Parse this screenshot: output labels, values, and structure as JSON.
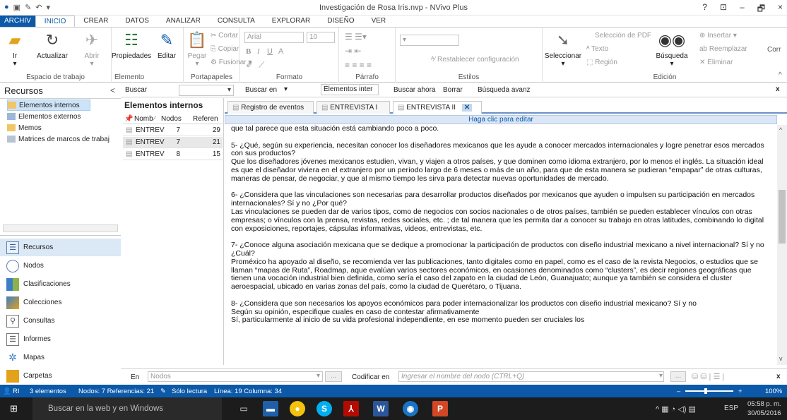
{
  "window": {
    "title": "Investigación de Rosa Iris.nvp - NVivo Plus",
    "controls": [
      "?",
      "⊡",
      "–",
      "🗗",
      "×"
    ]
  },
  "ribbon_tabs": [
    "ARCHIV",
    "INICIO",
    "CREAR",
    "DATOS",
    "ANALIZAR",
    "CONSULTA",
    "EXPLORAR",
    "DISEÑO",
    "VER"
  ],
  "ribbon": {
    "workspace": {
      "ir": "Ir",
      "actualizar": "Actualizar",
      "abrir": "Abrir",
      "label": "Espacio de trabajo"
    },
    "elemento": {
      "propiedades": "Propiedades",
      "editar": "Editar",
      "label": "Elemento"
    },
    "clipboard": {
      "pegar": "Pegar",
      "cortar": "Cortar",
      "copiar": "Copiar",
      "fusionar": "Fusionar",
      "label": "Portapapeles"
    },
    "formato": {
      "font": "Arial",
      "size": "10",
      "bold": "B",
      "italic": "I",
      "underline": "U",
      "fontcolor": "A",
      "label": "Formato"
    },
    "parrafo": {
      "label": "Párrafo"
    },
    "estilos": {
      "reset": "Restablecer configuración",
      "label": "Estilos"
    },
    "edicion": {
      "seleccionar": "Seleccionar",
      "seleccion_pdf": "Selección de PDF",
      "texto": "Texto",
      "region": "Región",
      "busqueda": "Búsqueda",
      "insertar": "Insertar",
      "reemplazar": "Reemplazar",
      "eliminar": "Eliminar",
      "label": "Edición",
      "cor": "Corr"
    }
  },
  "left_panel": {
    "title": "Recursos",
    "tree": [
      "Elementos internos",
      "Elementos externos",
      "Memos",
      "Matrices de marcos de trabaj"
    ],
    "nav": [
      "Recursos",
      "Nodos",
      "Clasificaciones",
      "Colecciones",
      "Consultas",
      "Informes",
      "Mapas",
      "Carpetas"
    ]
  },
  "find_bar": {
    "buscar": "Buscar",
    "buscar_en": "Buscar en",
    "scope": "Elementos inter",
    "buscar_ahora": "Buscar ahora",
    "borrar": "Borrar",
    "avanzada": "Búsqueda avanz",
    "close": "x"
  },
  "list": {
    "title": "Elementos internos",
    "columns": [
      "Nomb",
      "Nodos",
      "Referen"
    ],
    "rows": [
      {
        "name": "ENTREV",
        "nodos": "7",
        "refs": "29"
      },
      {
        "name": "ENTREV",
        "nodos": "7",
        "refs": "21"
      },
      {
        "name": "ENTREV",
        "nodos": "8",
        "refs": "15"
      }
    ]
  },
  "doc_tabs": [
    "Registro de eventos",
    "ENTREVISTA I",
    "ENTREVISTA II"
  ],
  "edit_banner": "Haga clic para editar",
  "document": {
    "paragraphs": [
      "que tal parece que esta situación está cambiando poco a poco.",
      "5- ¿Qué, según su experiencia, necesitan conocer los diseñadores mexicanos que les ayude a conocer mercados internacionales y logre penetrar esos mercados con sus productos?\nQue los diseñadores jóvenes mexicanos estudien, vivan, y viajen a otros países, y que dominen como idioma extranjero, por lo menos el inglés. La situación ideal es que el diseñador viviera en el extranjero por un período largo de 6 meses o más de un año, para que de esta manera se pudieran “empapar” de otras culturas, maneras de pensar, de negociar, y que al mismo tiempo les sirva para detectar nuevas oportunidades de mercado.",
      "6- ¿Considera que las vinculaciones son  necesarias para desarrollar productos diseñados por mexicanos que ayuden o impulsen su participación en mercados internacionales? Sí y no ¿Por qué?\nLas vinculaciones se pueden dar de varios tipos, como de negocios con socios nacionales o de otros países, también se pueden establecer vínculos con otras empresas; o vínculos con la prensa, revistas, redes sociales, etc. ; de tal manera que les permita dar a conocer su trabajo en otras latitudes, combinando lo digital con exposiciones, reportajes, cápsulas informativas, videos, entrevistas, etc.",
      "7- ¿Conoce alguna asociación mexicana que se dedique a promocionar la participación de productos con diseño industrial mexicano a nivel internacional?  Sí y no ¿Cuál?\nProméxico ha apoyado al diseño, se recomienda ver las publicaciones, tanto digitales como en papel, como es el caso de la revista Negocios, o estudios que se llaman “mapas de Ruta”, Roadmap, aque evalúan varios sectores económicos, en ocasiones denominados como “clusters”, es decir regiones geográficas que tienen una vocación industrial bien definida, como sería el caso del zapato en la ciudad de León, Guanajuato; aunque ya también se considera el cluster aeroespacial, ubicado en varias zonas del país, como la ciudad de Querétaro, o Tijuana.",
      "8- ¿Considera que son necesarios los apoyos económicos para poder internacionalizar los productos con diseño industrial mexicano? Sí y no\nSegún su opinión, especifique cuales en caso de contestar afirmativamente\nSí, particularmente al inicio de su vida profesional independiente, en ese momento pueden ser cruciales los"
    ]
  },
  "bottom_bar": {
    "en": "En",
    "nodos_placeholder": "Nodos",
    "codificar": "Codificar en",
    "node_placeholder": "Ingresar el nombre del nodo (CTRL+Q)",
    "close": "x"
  },
  "status": {
    "user": "RI",
    "elementos": "3 elementos",
    "counts": "Nodos: 7  Referencias: 21",
    "readonly": "Sólo lectura",
    "position": "Línea: 19  Columna: 34",
    "zoom": "100%"
  },
  "taskbar": {
    "search": "Buscar en la web y en Windows",
    "lang": "ESP",
    "time": "05:58 p. m.",
    "date": "30/05/2016"
  }
}
